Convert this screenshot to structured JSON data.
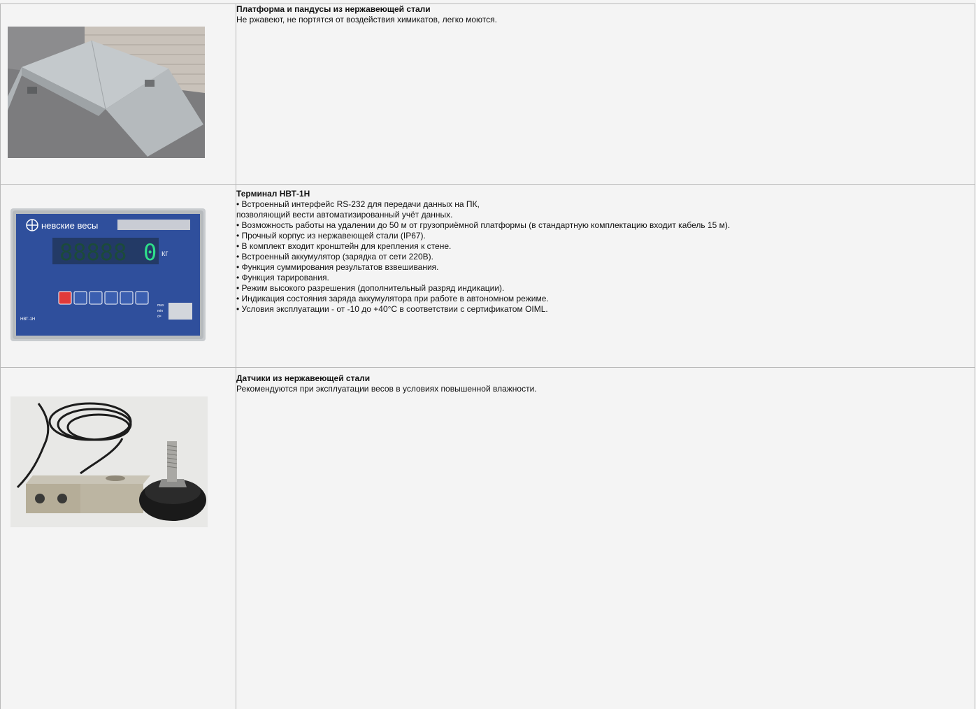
{
  "rows": [
    {
      "title": "Платформа и пандусы из нержавеющей стали",
      "lines": [
        "Не ржавеют, не портятся от воздействия химикатов, легко моются."
      ]
    },
    {
      "title": "Терминал НВТ-1Н",
      "lines": [
        "• Встроенный интерфейс RS-232 для передачи данных на ПК,",
        "позволяющий вести автоматизированный учёт данных.",
        "• Возможность работы на удалении до 50 м от грузоприёмной платформы (в стандартную комплектацию входит кабель 15 м).",
        "• Прочный корпус из нержавеющей стали (IP67).",
        "• В комплект входит кронштейн для крепления к стене.",
        "• Встроенный аккумулятор (зарядка от сети 220В).",
        "• Функция суммирования результатов взвешивания.",
        "• Функция тарирования.",
        "• Режим высокого разрешения (дополнительный разряд индикации).",
        "• Индикация состояния заряда аккумулятора при работе в автономном режиме.",
        "• Условия эксплуатации - от -10 до +40°C в соответствии с сертификатом OIML."
      ],
      "terminal": {
        "brand": "невские весы",
        "display_value": "0",
        "unit": "кг",
        "model": "НВТ-1Н",
        "side_labels": [
          "max",
          "min",
          "d="
        ]
      }
    },
    {
      "title": "Датчики из нержавеющей стали",
      "lines": [
        "Рекомендуются при эксплуатации весов в условиях повышенной влажности."
      ]
    }
  ],
  "colors": {
    "border": "#b9b9b9",
    "background": "#f4f4f4",
    "terminal_panel": "#2f4f9c",
    "display_digits": "#2ee08a"
  }
}
